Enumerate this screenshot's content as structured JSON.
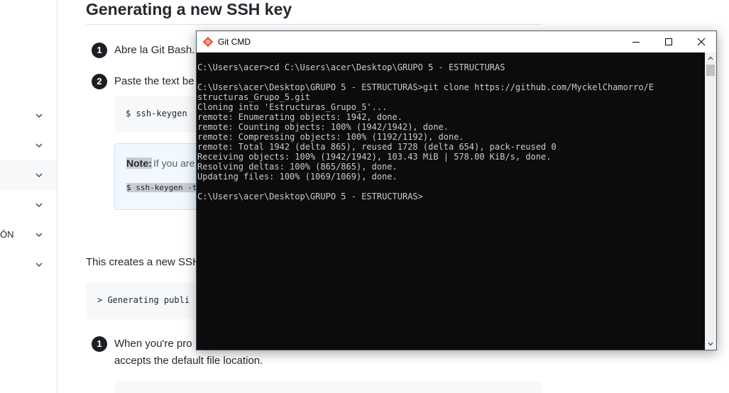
{
  "page": {
    "heading": "Generating a new SSH key",
    "sidebar": {
      "items": [
        {
          "label": ""
        },
        {
          "label": ""
        },
        {
          "label": ""
        },
        {
          "label": ""
        },
        {
          "label": "ÓN"
        },
        {
          "label": ""
        }
      ]
    },
    "steps": [
      {
        "number": "1",
        "text": "Abre la Git Bash."
      },
      {
        "number": "2",
        "text": "Paste the text be"
      },
      {
        "number": "1",
        "text": "When you're pro"
      }
    ],
    "code1": "$ ssh-keygen",
    "note": {
      "label": "Note:",
      "text": "If you are",
      "code": "$ ssh-keygen -t"
    },
    "para1": "This creates a new SSH",
    "code2": "> Generating publi",
    "step3_line2": "accepts the default file location."
  },
  "cmd": {
    "title": "Git CMD",
    "lines": [
      "C:\\Users\\acer>cd C:\\Users\\acer\\Desktop\\GRUPO 5 - ESTRUCTURAS",
      "",
      "C:\\Users\\acer\\Desktop\\GRUPO 5 - ESTRUCTURAS>git clone https://github.com/MyckelChamorro/E",
      "structuras_Grupo_5.git",
      "Cloning into 'Estructuras_Grupo_5'...",
      "remote: Enumerating objects: 1942, done.",
      "remote: Counting objects: 100% (1942/1942), done.",
      "remote: Compressing objects: 100% (1192/1192), done.",
      "remote: Total 1942 (delta 865), reused 1728 (delta 654), pack-reused 0",
      "Receiving objects: 100% (1942/1942), 103.43 MiB | 578.00 KiB/s, done.",
      "Resolving deltas: 100% (865/865), done.",
      "Updating files: 100% (1069/1069), done.",
      "",
      "C:\\Users\\acer\\Desktop\\GRUPO 5 - ESTRUCTURAS>"
    ]
  }
}
